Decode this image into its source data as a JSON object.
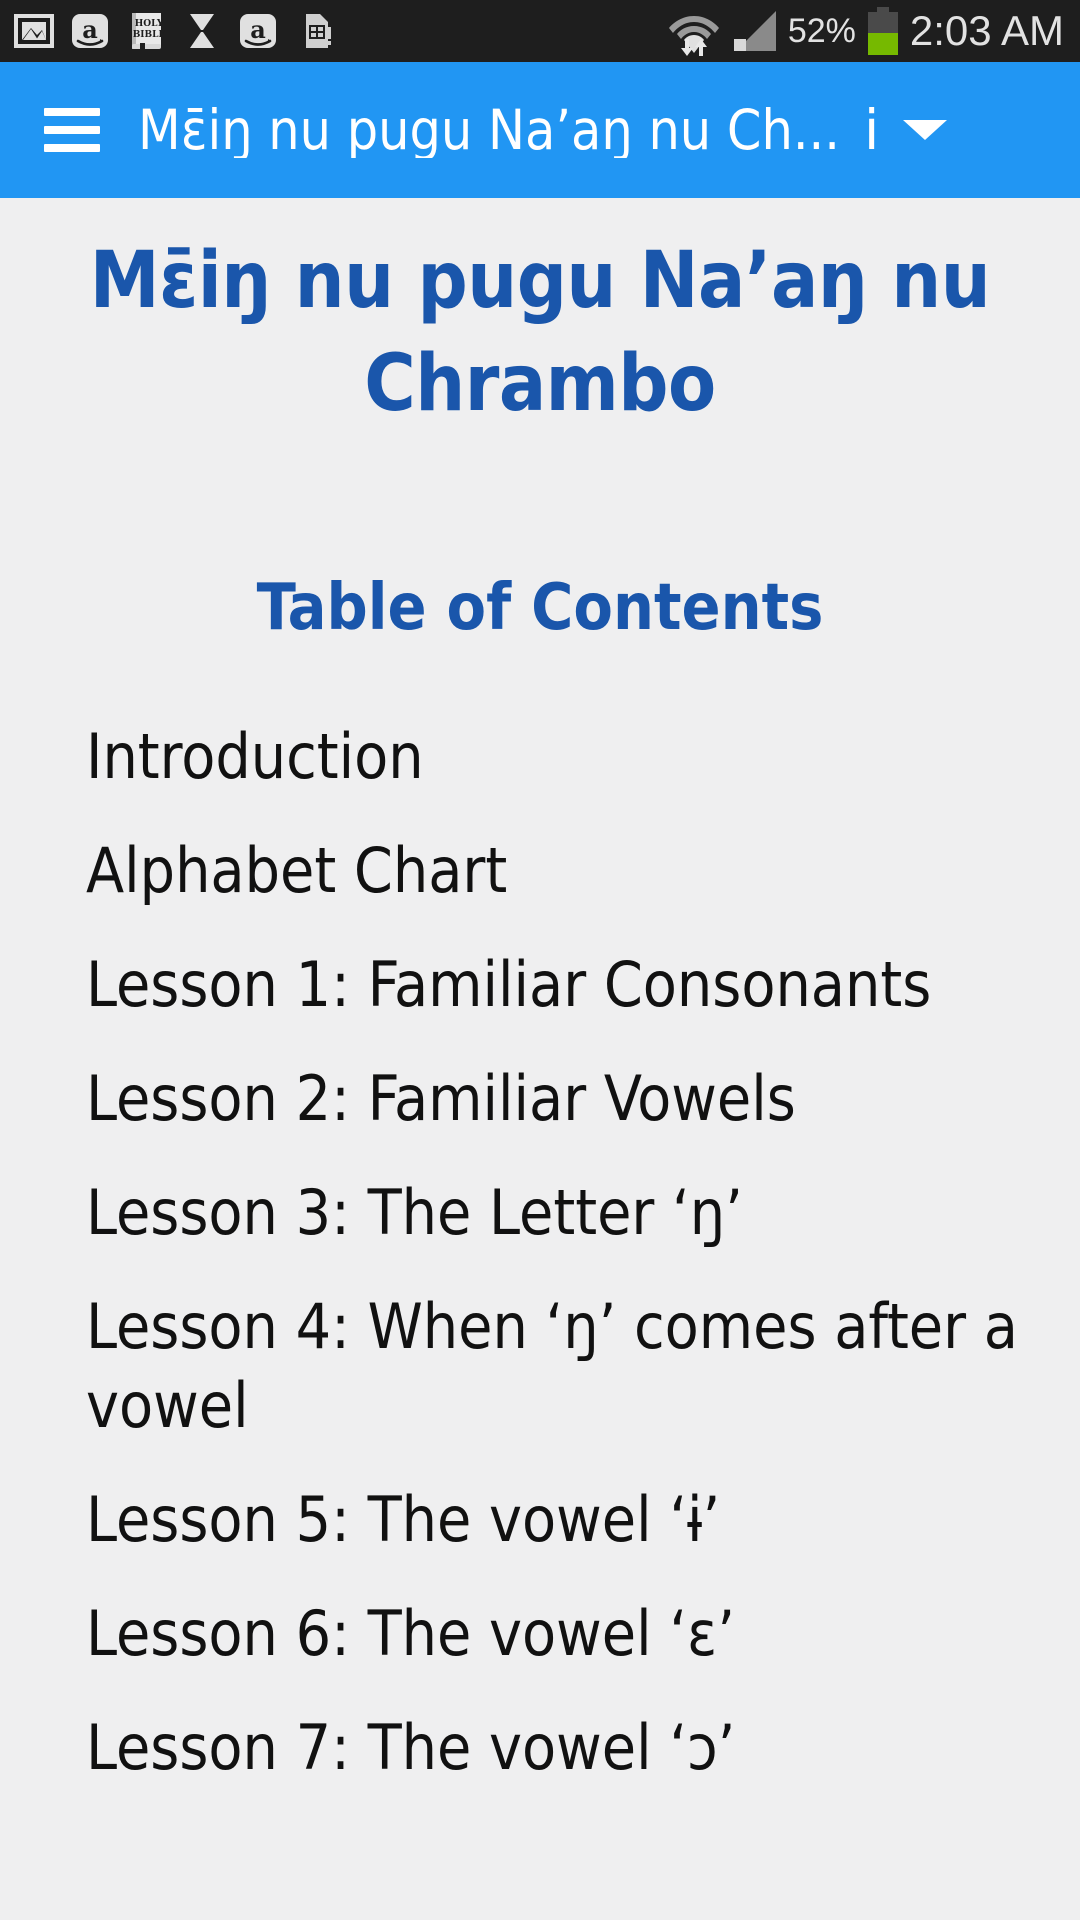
{
  "status_bar": {
    "left_icons": [
      {
        "name": "gallery-image-icon",
        "label": "Gallery"
      },
      {
        "name": "amazon-app-icon",
        "label": "Amazon"
      },
      {
        "name": "holy-bible-icon",
        "label": "HOLY BIBLE",
        "line1": "HOLY",
        "line2": "BIBLE"
      },
      {
        "name": "hourglass-icon",
        "label": "Hourglass"
      },
      {
        "name": "amazon-app-icon-2",
        "label": "Amazon"
      },
      {
        "name": "sim-card-alert-icon",
        "label": "SIM card"
      }
    ],
    "wifi_icon": "wifi-with-data-transfer-icon",
    "cell_signal_icon": "cell-signal-icon",
    "battery_percent": "52%",
    "battery_level": 52,
    "battery_icon": "battery-icon",
    "clock": "2:03 AM",
    "background_color": "#1e1e1e",
    "text_color": "#e2e2e2",
    "battery_fill_color": "#76b900"
  },
  "app_bar": {
    "menu_icon": "hamburger-menu-icon",
    "title": "Mɛ̄iŋ nu pugu Na’aŋ nu Ch...",
    "info_label": "i",
    "overflow_icon": "dropdown-caret-icon",
    "background_color": "#2196f3",
    "text_color": "#ffffff"
  },
  "content": {
    "document_title": "Mɛ̄iŋ nu pugu Na’aŋ nu Chrambo",
    "toc_heading": "Table of Contents",
    "heading_color": "#1a56ab",
    "background_color": "#efeff0",
    "toc_items": [
      {
        "label": "Introduction"
      },
      {
        "label": "Alphabet Chart"
      },
      {
        "label": "Lesson 1: Familiar Consonants"
      },
      {
        "label": "Lesson 2: Familiar Vowels"
      },
      {
        "label": "Lesson 3: The Letter ‘ŋ’"
      },
      {
        "label": "Lesson 4: When ‘ŋ’ comes after a vowel"
      },
      {
        "label": "Lesson 5: The vowel ‘ɨ’"
      },
      {
        "label": "Lesson 6: The vowel ‘ɛ’"
      },
      {
        "label": "Lesson 7: The vowel ‘ɔ’"
      }
    ]
  }
}
